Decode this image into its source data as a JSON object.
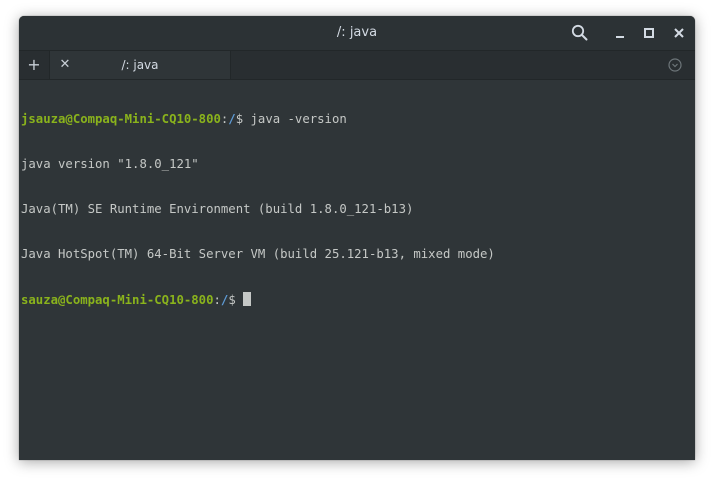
{
  "window": {
    "title": "/: java"
  },
  "titlebar_buttons": {
    "search_icon": "search-icon",
    "minimize_icon": "minimize-icon",
    "maximize_icon": "maximize-icon",
    "close_icon": "close-icon"
  },
  "tabs": {
    "new_tab_label": "+",
    "items": [
      {
        "label": "/: java",
        "close_label": "✕"
      }
    ],
    "menu_icon": "chevron-down-circle-icon"
  },
  "terminal": {
    "lines": [
      {
        "user": "jsauza@Compaq-Mini-CQ10-800",
        "sep": ":",
        "path": "/",
        "prompt": "$ ",
        "command": "java -version"
      },
      {
        "text": "java version \"1.8.0_121\""
      },
      {
        "text": "Java(TM) SE Runtime Environment (build 1.8.0_121-b13)"
      },
      {
        "text": "Java HotSpot(TM) 64-Bit Server VM (build 25.121-b13, mixed mode)"
      },
      {
        "user": "sauza@Compaq-Mini-CQ10-800",
        "sep": ":",
        "path": "/",
        "prompt": "$ ",
        "command": ""
      }
    ]
  },
  "colors": {
    "background": "#2f3538",
    "foreground": "#c5c8c6",
    "user_host": "#8ab31c",
    "path": "#5e9bd6"
  }
}
